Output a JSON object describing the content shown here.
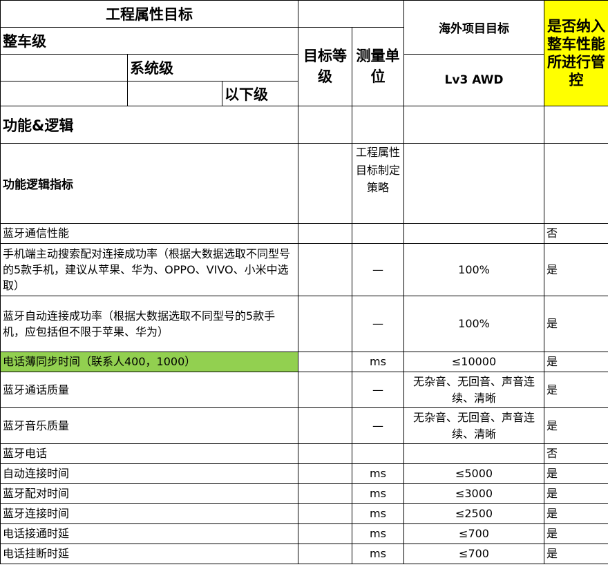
{
  "header": {
    "eng_target": "工程属性目标",
    "overseas": "海外项目目标",
    "control": "是否纳入整车性能所进行管控",
    "vehicle": "整车级",
    "system": "系统级",
    "below": "以下级",
    "grade": "目标等级",
    "unit": "测量单位",
    "lv": "Lv3  AWD"
  },
  "section": {
    "title": "功能&逻辑",
    "indicator": "功能逻辑指标",
    "strategy": "工程属性目标制定策略"
  },
  "rows": [
    {
      "name": "蓝牙通信性能",
      "grade": "",
      "unit": "",
      "target": "",
      "control": "否"
    },
    {
      "name": "手机端主动搜索配对连接成功率（根据大数据选取不同型号的5款手机，建议从苹果、华为、OPPO、VIVO、小米中选取）",
      "grade": "",
      "unit": "—",
      "target": "100%",
      "control": "是"
    },
    {
      "name": "蓝牙自动连接成功率（根据大数据选取不同型号的5款手机，应包括但不限于苹果、华为）",
      "grade": "",
      "unit": "—",
      "target": "100%",
      "control": "是"
    },
    {
      "name": "电话薄同步时间（联系人400，1000）",
      "grade": "",
      "unit": "ms",
      "target": "≤10000",
      "control": "是"
    },
    {
      "name": "蓝牙通话质量",
      "grade": "",
      "unit": "—",
      "target": "无杂音、无回音、声音连续、清晰",
      "control": "是"
    },
    {
      "name": "蓝牙音乐质量",
      "grade": "",
      "unit": "—",
      "target": "无杂音、无回音、声音连续、清晰",
      "control": "是"
    },
    {
      "name": "蓝牙电话",
      "grade": "",
      "unit": "",
      "target": "",
      "control": "否"
    },
    {
      "name": "自动连接时间",
      "grade": "",
      "unit": "ms",
      "target": "≤5000",
      "control": "是"
    },
    {
      "name": "蓝牙配对时间",
      "grade": "",
      "unit": "ms",
      "target": "≤3000",
      "control": "是"
    },
    {
      "name": "蓝牙连接时间",
      "grade": "",
      "unit": "ms",
      "target": "≤2500",
      "control": "是"
    },
    {
      "name": "电话接通时延",
      "grade": "",
      "unit": "ms",
      "target": "≤700",
      "control": "是"
    },
    {
      "name": "电话挂断时延",
      "grade": "",
      "unit": "ms",
      "target": "≤700",
      "control": "是"
    }
  ],
  "colors": {
    "highlight_yellow": "#ffff00",
    "highlight_green": "#92d050"
  }
}
